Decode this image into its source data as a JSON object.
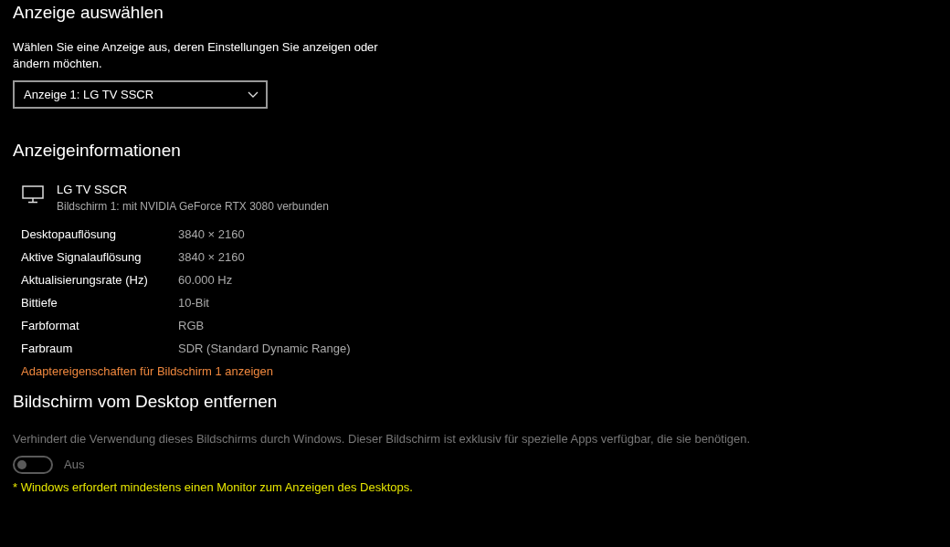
{
  "select_display": {
    "heading": "Anzeige auswählen",
    "description": "Wählen Sie eine Anzeige aus, deren Einstellungen Sie anzeigen oder ändern möchten.",
    "dropdown": {
      "value": "Anzeige 1: LG TV SSCR"
    }
  },
  "display_info": {
    "heading": "Anzeigeinformationen",
    "monitor_name": "LG TV SSCR",
    "monitor_subtitle": "Bildschirm 1: mit NVIDIA GeForce RTX 3080 verbunden",
    "properties": [
      {
        "label": "Desktopauflösung",
        "value": "3840 × 2160"
      },
      {
        "label": "Aktive Signalauflösung",
        "value": "3840 × 2160"
      },
      {
        "label": "Aktualisierungsrate (Hz)",
        "value": "60.000 Hz"
      },
      {
        "label": "Bittiefe",
        "value": "10-Bit"
      },
      {
        "label": "Farbformat",
        "value": "RGB"
      },
      {
        "label": "Farbraum",
        "value": "SDR (Standard Dynamic Range)"
      }
    ],
    "link": "Adaptereigenschaften für Bildschirm 1 anzeigen"
  },
  "remove_display": {
    "heading": "Bildschirm vom Desktop entfernen",
    "description": "Verhindert die Verwendung dieses Bildschirms durch Windows. Dieser Bildschirm ist exklusiv für spezielle Apps verfügbar, die sie benötigen.",
    "toggle": {
      "label": "Aus",
      "on": false,
      "disabled": true
    },
    "note": "* Windows erfordert mindestens einen Monitor zum Anzeigen des Desktops."
  }
}
